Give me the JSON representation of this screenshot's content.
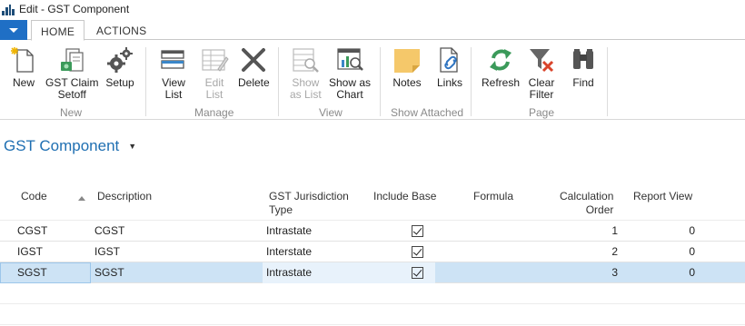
{
  "window": {
    "title": "Edit - GST Component"
  },
  "ribbon": {
    "tabs": [
      {
        "label": "HOME"
      },
      {
        "label": "ACTIONS"
      }
    ],
    "buttons": {
      "new": "New",
      "gst_claim_setoff_1": "GST Claim",
      "gst_claim_setoff_2": "Setoff",
      "setup": "Setup",
      "view_list_1": "View",
      "view_list_2": "List",
      "edit_list_1": "Edit",
      "edit_list_2": "List",
      "delete": "Delete",
      "show_as_list_1": "Show",
      "show_as_list_2": "as List",
      "show_as_chart_1": "Show as",
      "show_as_chart_2": "Chart",
      "notes": "Notes",
      "links": "Links",
      "refresh": "Refresh",
      "clear_filter_1": "Clear",
      "clear_filter_2": "Filter",
      "find": "Find"
    },
    "groups": {
      "new": "New",
      "manage": "Manage",
      "view": "View",
      "show_attached": "Show Attached",
      "page": "Page"
    }
  },
  "page": {
    "title": "GST Component"
  },
  "table": {
    "headers": {
      "code": "Code",
      "description": "Description",
      "jurisdiction_1": "GST Jurisdiction",
      "jurisdiction_2": "Type",
      "include_base": "Include Base",
      "formula": "Formula",
      "calc_order_1": "Calculation",
      "calc_order_2": "Order",
      "report_view": "Report View"
    },
    "rows": [
      {
        "code": "CGST",
        "description": "CGST",
        "jurisdiction": "Intrastate",
        "include_base": true,
        "formula": "",
        "calc_order": "1",
        "report_view": "0"
      },
      {
        "code": "IGST",
        "description": "IGST",
        "jurisdiction": "Interstate",
        "include_base": true,
        "formula": "",
        "calc_order": "2",
        "report_view": "0"
      },
      {
        "code": "SGST",
        "description": "SGST",
        "jurisdiction": "Intrastate",
        "include_base": true,
        "formula": "",
        "calc_order": "3",
        "report_view": "0"
      }
    ]
  },
  "colors": {
    "accent": "#1f6fc5",
    "selected_row": "#cde3f5",
    "title": "#1f6fb2"
  }
}
